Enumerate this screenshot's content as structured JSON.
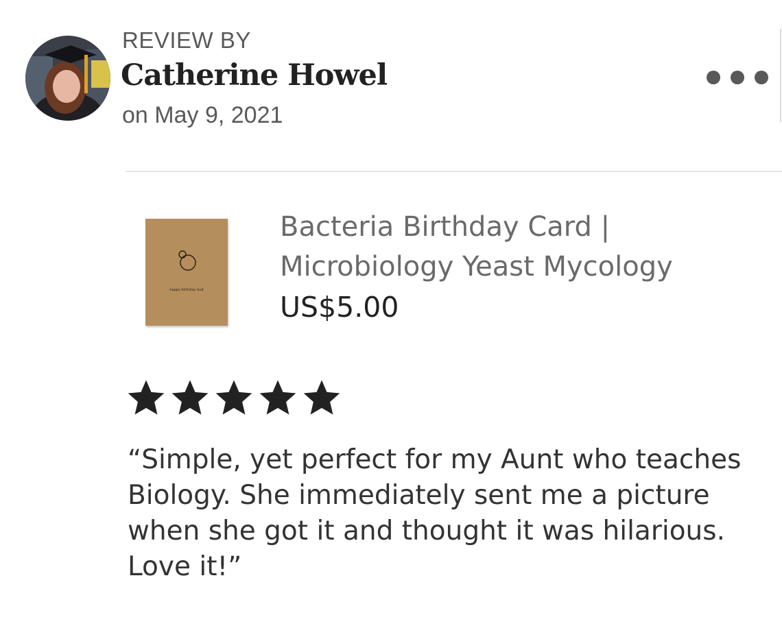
{
  "review": {
    "heading": "REVIEW BY",
    "reviewer_name": "Catherine Howel",
    "date": "on May 9, 2021",
    "avatar_icon": "avatar-photo-graduate",
    "more_icon": "more-options-icon"
  },
  "product": {
    "title": "Bacteria Birthday Card | Microbiology Yeast Mycology",
    "price": "US$5.00",
    "image_caption": "happy birthday bud",
    "image_color": "#b48e5d"
  },
  "rating": {
    "stars": 5,
    "max": 5,
    "star_color": "#222222"
  },
  "review_text": "“Simple, yet perfect for my Aunt who teaches Biology. She immediately sent me a picture when she got it and thought it was hilarious. Love it!”"
}
